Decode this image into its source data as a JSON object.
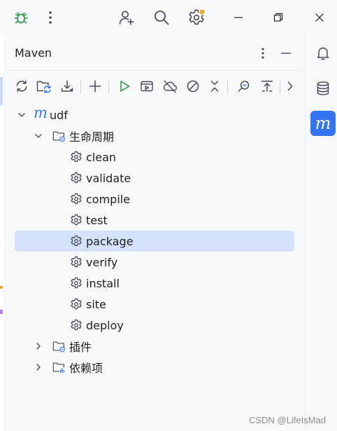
{
  "window": {
    "controls": {
      "minimize_icon": "minimize-icon",
      "restore_icon": "restore-icon",
      "close_icon": "close-icon"
    },
    "titlebar_icons": [
      "bug-icon",
      "kebab-menu-icon",
      "add-user-icon",
      "search-icon",
      "settings-icon"
    ],
    "settings_badge_color": "#f0a431"
  },
  "tool_window": {
    "title": "Maven",
    "toolbar": [
      "reload-icon",
      "reload-folder-icon",
      "download-icon",
      "add-icon",
      "run-icon",
      "run-config-icon",
      "offline-icon",
      "skip-tests-icon",
      "collapse-icon",
      "analyze-icon",
      "show-deps-icon",
      "more-icon"
    ],
    "tree": {
      "project": {
        "label": "udf",
        "icon": "maven-project-icon"
      },
      "lifecycle": {
        "label": "生命周期",
        "phases": [
          "clean",
          "validate",
          "compile",
          "test",
          "package",
          "verify",
          "install",
          "site",
          "deploy"
        ],
        "selected": "package"
      },
      "plugins": {
        "label": "插件"
      },
      "dependencies": {
        "label": "依赖项"
      }
    }
  },
  "right_stripe": {
    "buttons": [
      "notifications-icon",
      "database-icon",
      "maven-icon"
    ],
    "active": "maven-icon",
    "maven_glyph": "m"
  },
  "colors": {
    "accent": "#3574f0",
    "selection": "#d4e2fb",
    "run_green": "#3d9a50",
    "maven_blue": "#3574f0",
    "folder_blue": "#5181d6"
  },
  "watermark": "CSDN @LifeIsMad"
}
